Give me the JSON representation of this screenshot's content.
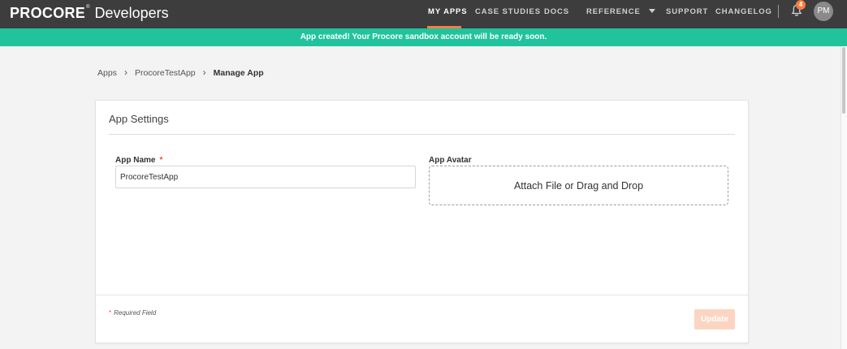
{
  "brand": {
    "logo": "PROCORE",
    "reg": "®",
    "suffix": "Developers"
  },
  "nav": {
    "items": [
      {
        "label": "MY APPS",
        "active": true
      },
      {
        "label": "CASE STUDIES"
      },
      {
        "label": "DOCS"
      },
      {
        "label": "REFERENCE"
      },
      {
        "label": "SUPPORT"
      },
      {
        "label": "CHANGELOG"
      }
    ],
    "notification_count": "4",
    "avatar_initials": "PM"
  },
  "banner": {
    "message": "App created! Your Procore sandbox account will be ready soon."
  },
  "breadcrumb": {
    "items": [
      "Apps",
      "ProcoreTestApp"
    ],
    "current": "Manage App"
  },
  "card": {
    "title": "App Settings",
    "app_name": {
      "label": "App Name",
      "required_mark": "*",
      "value": "ProcoreTestApp"
    },
    "app_avatar": {
      "label": "App Avatar",
      "dropzone_text": "Attach File or Drag and Drop"
    },
    "required_note": {
      "star": "*",
      "text": "Required Field"
    },
    "update_label": "Update"
  },
  "colors": {
    "nav_bg": "#3d3d3d",
    "accent": "#f47e42",
    "banner_bg": "#21c39c",
    "update_disabled": "#fbd5c2"
  }
}
